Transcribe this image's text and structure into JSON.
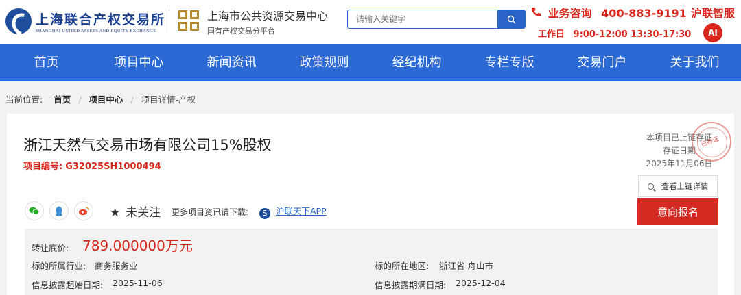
{
  "header": {
    "logo1_cn": "上海联合产权交易所",
    "logo1_en": "SHANGHAI UNITED ASSETS AND EQUITY EXCHANGE",
    "logo2_cn": "上海市公共资源交易中心",
    "logo2_sub": "国有产权交易分平台",
    "search_placeholder": "请输入关键字",
    "contact_label": "业务咨询",
    "contact_phone": "400-883-9191",
    "hours_label": "工作日",
    "hours": "9:00-12:00 13:30-17:30",
    "ai_title": "沪联智服",
    "ai_icon_text": "AI"
  },
  "nav": [
    "首页",
    "项目中心",
    "新闻资讯",
    "政策规则",
    "经纪机构",
    "专栏专版",
    "交易门户",
    "关于我们"
  ],
  "breadcrumb": {
    "label": "当前位置:",
    "home": "首页",
    "center": "项目中心",
    "current": "项目详情-产权"
  },
  "project": {
    "title": "浙江天然气交易市场有限公司15%股权",
    "code_label": "项目编号:",
    "code": "G32025SH1000494",
    "chain_line1": "本项目已上链存证",
    "chain_line2": "存证日期",
    "chain_date": "2025年11月06日",
    "seal_text": "已存证",
    "chain_btn": "查看上链详情",
    "apply_btn": "意向报名",
    "follow": "未关注",
    "more_text": "更多项目资讯请下载:",
    "app_icon_text": "S",
    "app_link": "沪联天下APP",
    "share_icons": [
      "wechat-icon",
      "qq-icon",
      "weibo-icon"
    ]
  },
  "info": {
    "price_label": "转让底价:",
    "price": "789.000000万元",
    "industry_label": "标的所属行业:",
    "industry": "商务服务业",
    "region_label": "标的所在地区:",
    "region": "浙江省 舟山市",
    "start_label": "信息披露起始日期:",
    "start": "2025-11-06",
    "end_label": "信息披露期满日期:",
    "end": "2025-12-04"
  },
  "colors": {
    "primary": "#2b69d4",
    "accent_red": "#d9261c",
    "brand_blue": "#1f4e9c",
    "brand_gold": "#b58a2a"
  }
}
